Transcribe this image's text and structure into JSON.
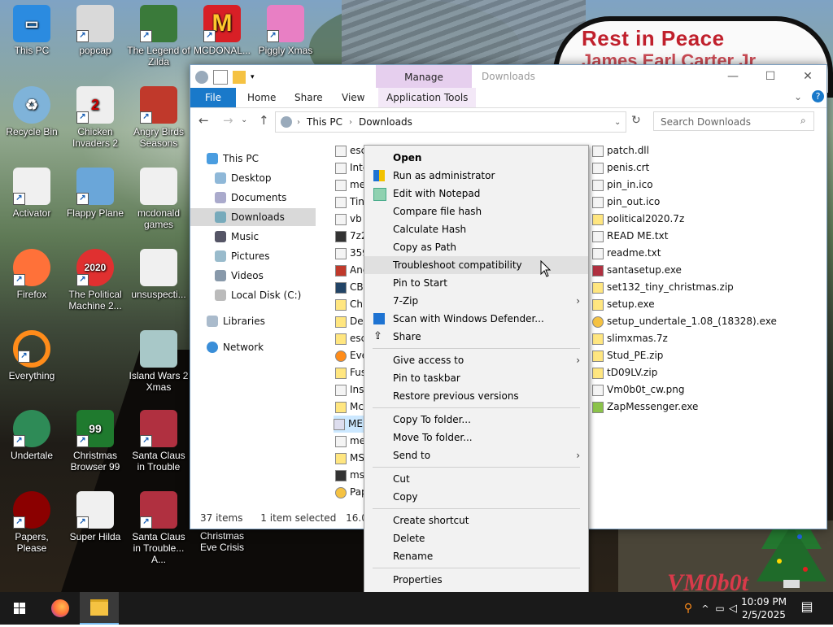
{
  "wallpaper": {
    "sign_line1": "Rest in Peace",
    "sign_line2": "James Earl Carter Jr",
    "watermark": "VM0b0t"
  },
  "desktop_icons": [
    {
      "label": "This PC",
      "icon": "computer-icon",
      "color": "#2b8be0"
    },
    {
      "label": "popcap",
      "icon": "popcap-icon",
      "color": "#d9d9d9"
    },
    {
      "label": "The Legend of Zilda",
      "icon": "zelda-icon",
      "color": "#3a7a3a"
    },
    {
      "label": "MCDONAL...",
      "icon": "mcdonalds-icon",
      "color": "#d81f26"
    },
    {
      "label": "Piggly Xmas",
      "icon": "pig-icon",
      "color": "#e87fc4"
    },
    {
      "label": "Recycle Bin",
      "icon": "recycle-bin-icon",
      "color": "#7fb3d9"
    },
    {
      "label": "Chicken Invaders 2",
      "icon": "chicken-icon",
      "color": "#eeeeee"
    },
    {
      "label": "Angry Birds Seasons",
      "icon": "angry-birds-icon",
      "color": "#c0392b"
    },
    {
      "label": "Activator",
      "icon": "file-icon",
      "color": "#f0f0f0"
    },
    {
      "label": "Flappy Plane",
      "icon": "flappy-icon",
      "color": "#6aa6d9"
    },
    {
      "label": "mcdonald games",
      "icon": "file-icon",
      "color": "#f0f0f0"
    },
    {
      "label": "Firefox",
      "icon": "firefox-icon",
      "color": "#ff7139"
    },
    {
      "label": "The Political Machine 2...",
      "icon": "political-icon",
      "color": "#e03030"
    },
    {
      "label": "unsuspecti...",
      "icon": "file-icon",
      "color": "#f0f0f0"
    },
    {
      "label": "Everything",
      "icon": "everything-icon",
      "color": "#ff8c1a"
    },
    {
      "label": "Island Wars 2 Xmas",
      "icon": "island-icon",
      "color": "#a8c8c8"
    },
    {
      "label": "Undertale",
      "icon": "undertale-icon",
      "color": "#2e8b57"
    },
    {
      "label": "Christmas Browser 99",
      "icon": "xmas-tree-icon",
      "color": "#1f7a2e"
    },
    {
      "label": "Santa Claus in Trouble",
      "icon": "santa-icon",
      "color": "#b03040"
    },
    {
      "label": "Papers, Please",
      "icon": "papers-please-icon",
      "color": "#8b0000"
    },
    {
      "label": "Super Hilda",
      "icon": "hilda-icon",
      "color": "#f0f0f0"
    },
    {
      "label": "Santa Claus in Trouble... A...",
      "icon": "santa-icon",
      "color": "#b03040"
    },
    {
      "label": "Christmas Eve Crisis",
      "icon": "file-icon",
      "color": "#555555"
    }
  ],
  "explorer": {
    "title": "Downloads",
    "manage_tab": "Manage",
    "tabs": [
      "File",
      "Home",
      "Share",
      "View",
      "Application Tools"
    ],
    "breadcrumb": [
      "This PC",
      "Downloads"
    ],
    "search_placeholder": "Search Downloads",
    "nav": [
      "This PC",
      "Desktop",
      "Documents",
      "Downloads",
      "Music",
      "Pictures",
      "Videos",
      "Local Disk (C:)",
      "Libraries",
      "Network"
    ],
    "files_left": [
      "esca",
      "Inte",
      "mes",
      "Tiny",
      "vb",
      "7z24",
      "359",
      "Ang",
      "CB9",
      "Chi",
      "Des",
      "esca",
      "Eve",
      "Fus",
      "Inst",
      "Mcl",
      "MEI",
      "mes",
      "MSI",
      "msn",
      "Pap"
    ],
    "files_right": [
      "patch.dll",
      "penis.crt",
      "pin_in.ico",
      "pin_out.ico",
      "political2020.7z",
      "READ ME.txt",
      "readme.txt",
      "santasetup.exe",
      "set132_tiny_christmas.zip",
      "setup.exe",
      "setup_undertale_1.08_(18328).exe",
      "slimxmas.7z",
      "Stud_PE.zip",
      "tD09LV.zip",
      "Vm0b0t_cw.png",
      "ZapMessenger.exe"
    ],
    "status_items": "37 items",
    "status_selected": "1 item selected",
    "status_size": "16.0 KB"
  },
  "context_menu": {
    "items": [
      {
        "label": "Open",
        "bold": true,
        "icon": ""
      },
      {
        "label": "Run as administrator",
        "icon": "shield-icon"
      },
      {
        "label": "Edit with Notepad",
        "icon": "notepad-icon"
      },
      {
        "label": "Compare file hash",
        "icon": ""
      },
      {
        "label": "Calculate Hash",
        "icon": ""
      },
      {
        "label": "Copy as Path",
        "icon": ""
      },
      {
        "label": "Troubleshoot compatibility",
        "icon": "",
        "hover": true
      },
      {
        "label": "Pin to Start",
        "icon": ""
      },
      {
        "label": "7-Zip",
        "icon": "",
        "submenu": true
      },
      {
        "label": "Scan with Windows Defender...",
        "icon": "defender-icon"
      },
      {
        "label": "Share",
        "icon": "share-icon"
      },
      {
        "label": "Give access to",
        "icon": "",
        "submenu": true
      },
      {
        "label": "Pin to taskbar",
        "icon": ""
      },
      {
        "label": "Restore previous versions",
        "icon": ""
      },
      {
        "label": "Copy To folder...",
        "icon": ""
      },
      {
        "label": "Move To folder...",
        "icon": ""
      },
      {
        "label": "Send to",
        "icon": "",
        "submenu": true
      },
      {
        "label": "Cut",
        "icon": ""
      },
      {
        "label": "Copy",
        "icon": ""
      },
      {
        "label": "Create shortcut",
        "icon": ""
      },
      {
        "label": "Delete",
        "icon": ""
      },
      {
        "label": "Rename",
        "icon": ""
      },
      {
        "label": "Properties",
        "icon": ""
      }
    ]
  },
  "taskbar": {
    "time": "10:09 PM",
    "date": "2/5/2025"
  }
}
